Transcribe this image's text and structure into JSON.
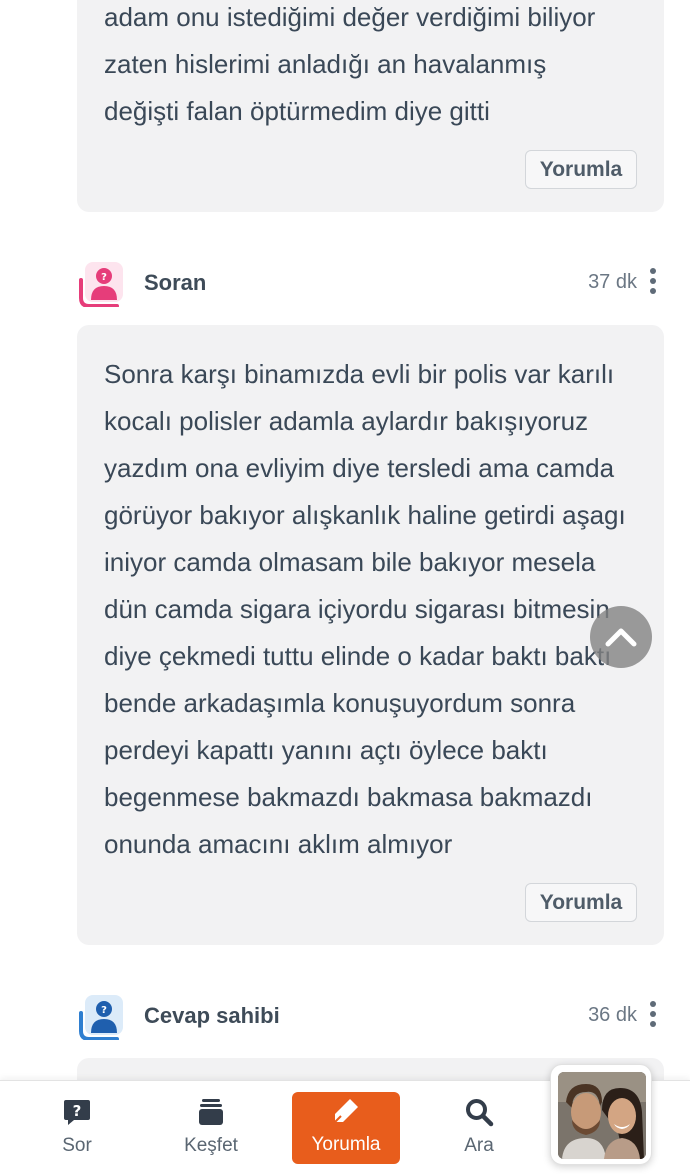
{
  "answers": [
    {
      "text": "adam onu istediğimi değer verdiğimi biliyor\nzaten hislerimi anladığı an havalanmış\ndeğişti falan öptürmedim diye gitti",
      "reply_label": "Yorumla"
    },
    {
      "author": "Soran",
      "time": "37 dk",
      "text": "Sonra karşı binamızda evli bir polis var karılı\nkocalı polisler adamla aylardır bakışıyoruz\nyazdım ona evliyim diye tersledi ama camda\ngörüyor bakıyor alışkanlık haline getirdi aşagı\niniyor camda olmasam bile bakıyor mesela\ndün camda sigara içiyordu sigarası bitmesin\ndiye çekmedi tuttu elinde o kadar baktı baktı\nbende arkadaşımla konuşuyordum sonra\nperdeyi kapattı yanını açtı öylece baktı\nbegenmese bakmazdı bakmasa bakmazdı\nonunda amacını aklım almıyor",
      "reply_label": "Yorumla"
    },
    {
      "author": "Cevap sahibi",
      "time": "36 dk"
    }
  ],
  "colors": {
    "asker_avatar": "#e63d7a",
    "answerer_avatar": "#2f7fd0",
    "accent": "#e85d1c"
  },
  "bottom_nav": {
    "items": [
      {
        "label": "Sor",
        "icon": "question-bubble-icon"
      },
      {
        "label": "Keşfet",
        "icon": "stack-icon"
      },
      {
        "label": "Yorumla",
        "icon": "pencil-icon",
        "active": true
      },
      {
        "label": "Ara",
        "icon": "search-icon"
      }
    ]
  },
  "promo": {
    "icon": "couple-photo"
  }
}
